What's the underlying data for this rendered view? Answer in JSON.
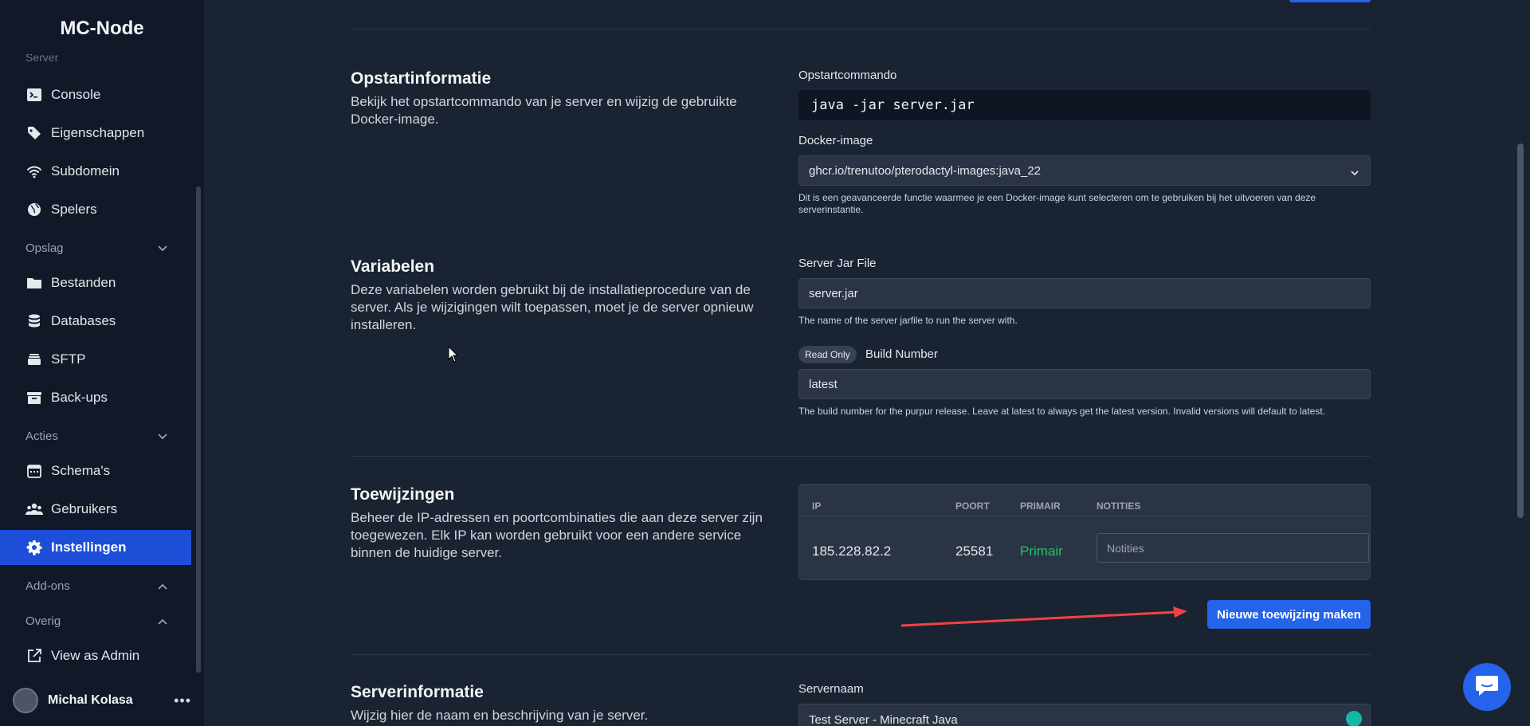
{
  "app": {
    "brand": "MC-Node"
  },
  "sidebar": {
    "cutoff_label": "Server",
    "items_top": [
      {
        "label": "Console",
        "icon": "terminal-icon"
      },
      {
        "label": "Eigenschappen",
        "icon": "tag-icon"
      },
      {
        "label": "Subdomein",
        "icon": "wifi-icon"
      },
      {
        "label": "Spelers",
        "icon": "globe-icon"
      }
    ],
    "opslag": {
      "label": "Opslag",
      "items": [
        {
          "label": "Bestanden",
          "icon": "folder-icon"
        },
        {
          "label": "Databases",
          "icon": "database-icon"
        },
        {
          "label": "SFTP",
          "icon": "stack-icon"
        },
        {
          "label": "Back-ups",
          "icon": "archive-icon"
        }
      ]
    },
    "acties": {
      "label": "Acties",
      "items": [
        {
          "label": "Schema's",
          "icon": "calendar-icon"
        },
        {
          "label": "Gebruikers",
          "icon": "users-icon"
        },
        {
          "label": "Instellingen",
          "icon": "gear-icon"
        }
      ]
    },
    "addons": {
      "label": "Add-ons"
    },
    "overig": {
      "label": "Overig",
      "items": [
        {
          "label": "View as Admin",
          "icon": "external-link-icon"
        }
      ]
    },
    "user": {
      "name": "Michal Kolasa",
      "menu": "•••"
    }
  },
  "startup": {
    "title": "Opstartinformatie",
    "description": "Bekijk het opstartcommando van je server en wijzig de gebruikte Docker-image.",
    "command_label": "Opstartcommando",
    "command": "java -jar server.jar",
    "docker_label": "Docker-image",
    "docker_value": "ghcr.io/trenutoo/pterodactyl-images:java_22",
    "docker_help": "Dit is een geavanceerde functie waarmee je een Docker-image kunt selecteren om te gebruiken bij het uitvoeren van deze serverinstantie."
  },
  "variables": {
    "title": "Variabelen",
    "description": "Deze variabelen worden gebruikt bij de installatieprocedure van de server. Als je wijzigingen wilt toepassen, moet je de server opnieuw installeren.",
    "jar_label": "Server Jar File",
    "jar_value": "server.jar",
    "jar_help": "The name of the server jarfile to run the server with.",
    "readonly_badge": "Read Only",
    "build_label": "Build Number",
    "build_value": "latest",
    "build_help": "The build number for the purpur release. Leave at latest to always get the latest version. Invalid versions will default to latest."
  },
  "allocations": {
    "title": "Toewijzingen",
    "description": "Beheer de IP-adressen en poortcombinaties die aan deze server zijn toegewezen. Elk IP kan worden gebruikt voor een andere service binnen de huidige server.",
    "headers": {
      "ip": "IP",
      "port": "POORT",
      "primary": "PRIMAIR",
      "notes": "NOTITIES"
    },
    "rows": [
      {
        "ip": "185.228.82.2",
        "port": "25581",
        "primary": "Primair",
        "notes_placeholder": "Notities"
      }
    ],
    "new_button": "Nieuwe toewijzing maken",
    "primary_color": "#22c55e"
  },
  "serverinfo": {
    "title": "Serverinformatie",
    "description": "Wijzig hier de naam en beschrijving van je server.",
    "name_label": "Servernaam",
    "name_value": "Test Server - Minecraft Java"
  },
  "colors": {
    "accent": "#2563eb",
    "arrow": "#ef4444"
  }
}
